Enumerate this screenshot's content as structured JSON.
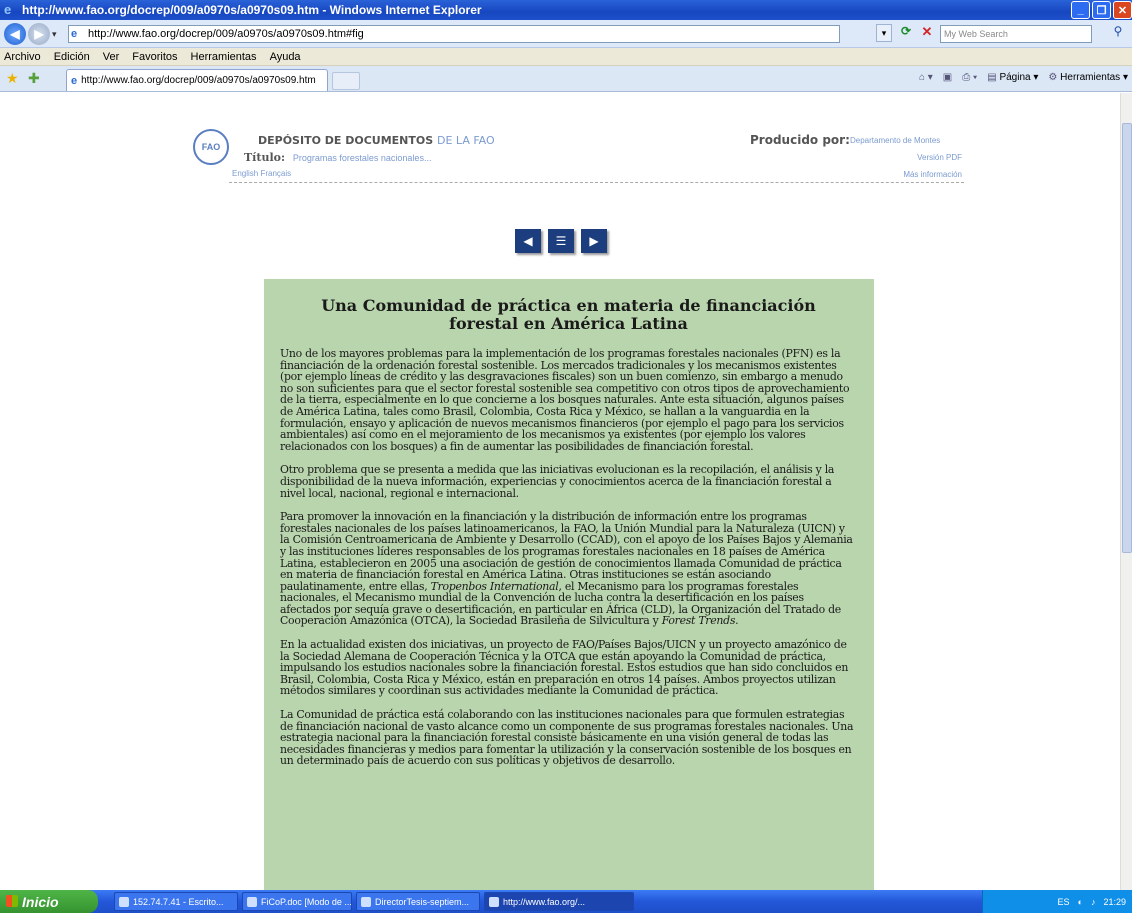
{
  "window": {
    "title": "http://www.fao.org/docrep/009/a0970s/a0970s09.htm - Windows Internet Explorer"
  },
  "address_bar": {
    "url": "http://www.fao.org/docrep/009/a0970s/a0970s09.htm#fig",
    "search_placeholder": "My Web Search"
  },
  "menu": [
    "Archivo",
    "Edición",
    "Ver",
    "Favoritos",
    "Herramientas",
    "Ayuda"
  ],
  "tab": {
    "title": "http://www.fao.org/docrep/009/a0970s/a0970s09.htm"
  },
  "toolbar": {
    "page_label": "Página",
    "tools_label": "Herramientas"
  },
  "fao_header": {
    "logo_text": "FAO",
    "repo_label_bold": "DEPÓSITO DE DOCUMENTOS",
    "repo_label_light": "DE LA FAO",
    "titulo_label": "Título:",
    "titulo_value": "Programas forestales nacionales...",
    "languages": "English  Français",
    "produced_by_label": "Producido por:",
    "produced_by_value": "Departamento de Montes",
    "version_pdf": "Versión PDF",
    "more_info": "Más información"
  },
  "nav": {
    "prev_symbol": "◀",
    "toc_symbol": "☰",
    "next_symbol": "▶"
  },
  "article": {
    "title": "Una Comunidad de práctica en materia de financiación forestal en América Latina",
    "p1": "Uno de los mayores problemas para la implementación de los programas forestales nacionales (PFN) es la financiación de la ordenación forestal sostenible. Los mercados tradicionales y los mecanismos existentes (por ejemplo líneas de crédito y las desgravaciones fiscales) son un buen comienzo, sin embargo a menudo no son suficientes para que el sector forestal sostenible sea competitivo con otros tipos de aprovechamiento de la tierra, especialmente en lo que concierne a los bosques naturales. Ante esta situación, algunos países de América Latina, tales como Brasil, Colombia, Costa Rica y México, se hallan a la vanguardia en la formulación, ensayo y aplicación de nuevos mecanismos financieros (por ejemplo el pago para los servicios ambientales) así como en el mejoramiento de los mecanismos ya existentes (por ejemplo los valores relacionados con los bosques) a fin de aumentar las posibilidades de financiación forestal.",
    "p2": "Otro problema que se presenta a medida que las iniciativas evolucionan es la recopilación, el análisis y la disponibilidad de la nueva información, experiencias y conocimientos acerca de la financiación forestal a nivel local, nacional, regional e internacional.",
    "p3_a": "Para promover la innovación en la financiación y la distribución de información entre los programas forestales nacionales de los países latinoamericanos, la FAO, la Unión Mundial para la Naturaleza (UICN) y la Comisión Centroamericana de Ambiente y Desarrollo (CCAD), con el apoyo de los Países Bajos y Alemania y las instituciones líderes responsables de los programas forestales nacionales en 18 países de América Latina, establecieron en 2005 una asociación de gestión de conocimientos llamada Comunidad de práctica en materia de financiación forestal en América Latina. Otras instituciones se están asociando paulatinamente, entre ellas, ",
    "p3_italic1": "Tropenbos International",
    "p3_b": ", el Mecanismo para los programas forestales nacionales, el Mecanismo mundial de la Convención de lucha contra la desertificación en los países afectados por sequía grave o desertificación, en particular en África (CLD), la Organización del Tratado de Cooperación Amazónica (OTCA), la Sociedad Brasileña de Silvicultura y ",
    "p3_italic2": "Forest Trends",
    "p3_c": ".",
    "p4": "En la actualidad existen dos iniciativas, un proyecto de FAO/Países Bajos/UICN y un proyecto amazónico de la Sociedad Alemana de Cooperación Técnica y la OTCA que están apoyando la Comunidad de práctica, impulsando los estudios nacionales sobre la financiación forestal. Estos estudios que han sido concluidos en Brasil, Colombia, Costa Rica y México, están en preparación en otros 14 países. Ambos proyectos utilizan métodos similares y coordinan sus actividades mediante la Comunidad de práctica.",
    "p5": "La Comunidad de práctica está colaborando con las instituciones nacionales para que formulen estrategias de financiación nacional de vasto alcance como un componente de sus programas forestales nacionales. Una estrategia nacional para la financiación forestal consiste básicamente en una visión general de todas las necesidades financieras y medios para fomentar la utilización y la conservación sostenible de los bosques en un determinado país de acuerdo con sus políticas y objetivos de desarrollo."
  },
  "taskbar": {
    "start_label": "Inicio",
    "tasks": [
      "152.74.7.41 - Escrito...",
      "FiCoP.doc [Modo de ...",
      "DirectorTesis-septiem...",
      "http://www.fao.org/..."
    ],
    "lang": "ES",
    "clock": "21:29"
  }
}
